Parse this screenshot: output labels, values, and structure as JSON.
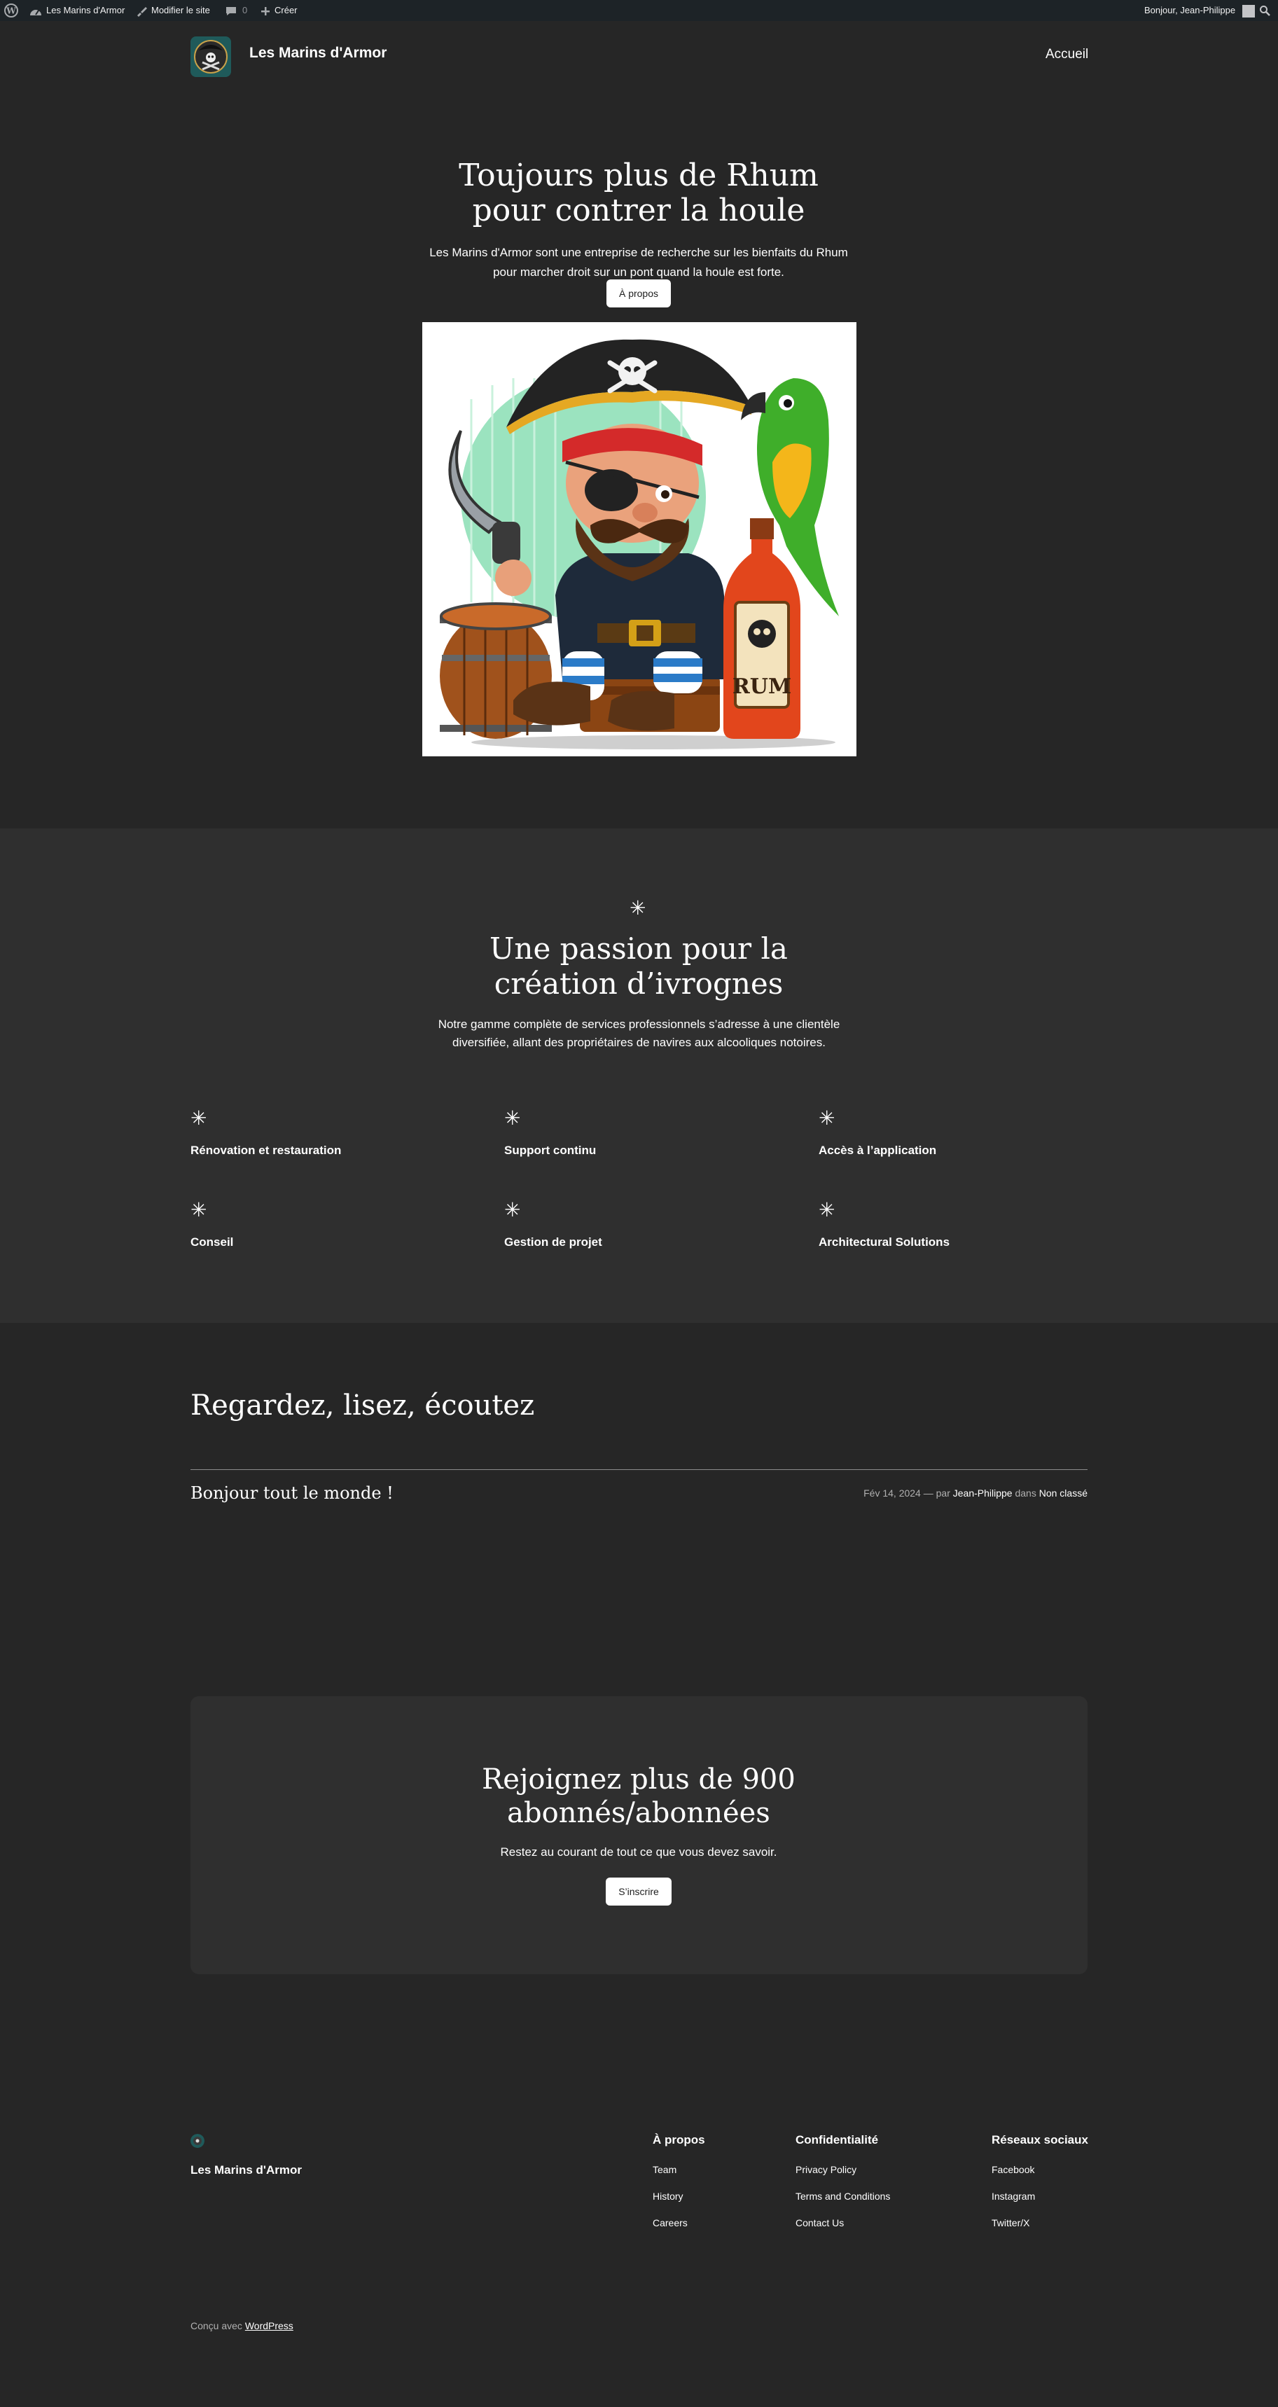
{
  "admin_bar": {
    "site_name": "Les Marins d'Armor",
    "edit_site": "Modifier le site",
    "comments_count": "0",
    "new": "Créer",
    "greeting": "Bonjour, Jean-Philippe"
  },
  "header": {
    "site_title": "Les Marins d'Armor",
    "nav": [
      "Accueil"
    ]
  },
  "hero": {
    "title": "Toujours plus de Rhum pour contrer la houle",
    "text": "Les Marins d'Armor sont une entreprise de recherche sur les bienfaits du Rhum pour marcher droit sur un pont quand la houle est forte.",
    "button": "À propos",
    "image_label": "RUM"
  },
  "services": {
    "title": "Une passion pour la création d’ivrognes",
    "text": "Notre gamme complète de services professionnels s’adresse à une clientèle diversifiée, allant des propriétaires de navires aux alcooliques notoires.",
    "items": [
      "Rénovation et restauration",
      "Support continu",
      "Accès à l’application",
      "Conseil",
      "Gestion de projet",
      "Architectural Solutions"
    ]
  },
  "blog": {
    "title": "Regardez, lisez, écoutez",
    "posts": [
      {
        "title": "Bonjour tout le monde !",
        "date": "Fév 14, 2024",
        "by": "— par",
        "author": "Jean-Philippe",
        "in": "dans",
        "category": "Non classé"
      }
    ]
  },
  "newsletter": {
    "title": "Rejoignez plus de 900 abonnés/abonnées",
    "text": "Restez au courant de tout ce que vous devez savoir.",
    "button": "S’inscrire"
  },
  "footer": {
    "site_title": "Les Marins d'Armor",
    "columns": [
      {
        "title": "À propos",
        "links": [
          "Team",
          "History",
          "Careers"
        ]
      },
      {
        "title": "Confidentialité",
        "links": [
          "Privacy Policy",
          "Terms and Conditions",
          "Contact Us"
        ]
      },
      {
        "title": "Réseaux sociaux",
        "links": [
          "Facebook",
          "Instagram",
          "Twitter/X"
        ]
      }
    ],
    "credits_prefix": "Conçu avec",
    "credits_link": "WordPress"
  }
}
